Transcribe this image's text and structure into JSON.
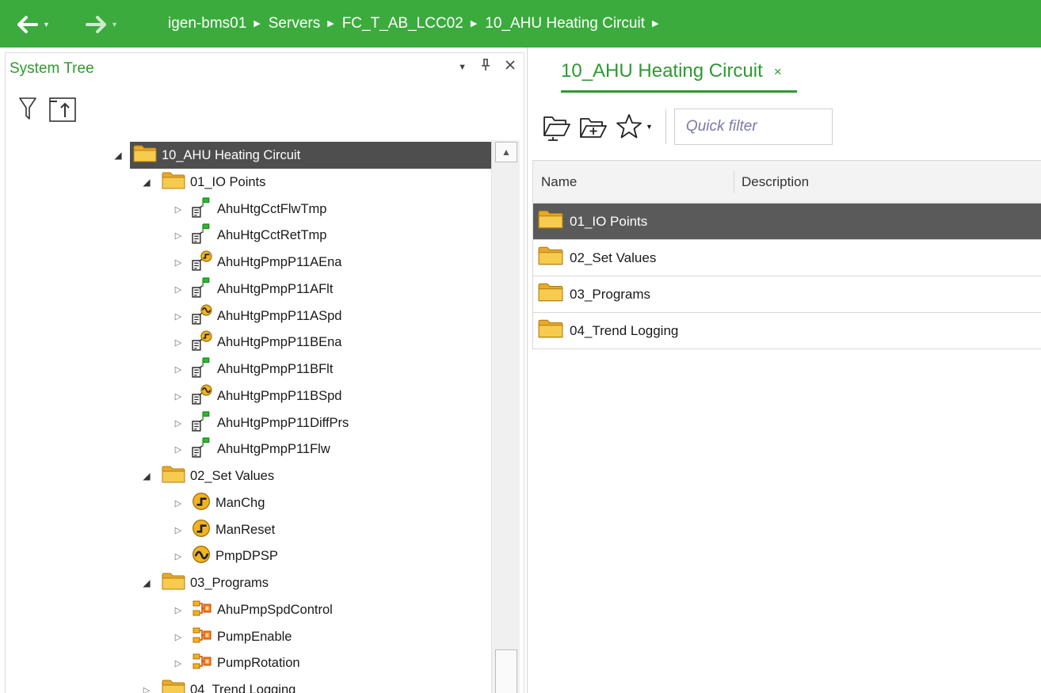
{
  "theme": {
    "accent": "#3bab3d",
    "accent_text": "#2e9a31",
    "selection": "#4e4e4e"
  },
  "nav": {
    "back_icon": "arrow-left-icon",
    "forward_icon": "arrow-right-icon",
    "breadcrumb": [
      "igen-bms01",
      "Servers",
      "FC_T_AB_LCC02",
      "10_AHU Heating Circuit"
    ]
  },
  "tree_panel": {
    "title": "System Tree",
    "header_icons": [
      "dropdown-icon",
      "pin-icon",
      "close-icon"
    ],
    "toolbar_icons": [
      "filter-icon",
      "go-to-parent-icon"
    ]
  },
  "tree": [
    {
      "label": "10_AHU Heating Circuit",
      "icon": "folder",
      "level": 0,
      "expanded": true,
      "selected": true
    },
    {
      "label": "01_IO Points",
      "icon": "folder",
      "level": 1,
      "expanded": true
    },
    {
      "label": "AhuHtgCctFlwTmp",
      "icon": "io-analog-input",
      "level": 2,
      "expanded": false
    },
    {
      "label": "AhuHtgCctRetTmp",
      "icon": "io-analog-input",
      "level": 2,
      "expanded": false
    },
    {
      "label": "AhuHtgPmpP11AEna",
      "icon": "io-digital-output",
      "level": 2,
      "expanded": false
    },
    {
      "label": "AhuHtgPmpP11AFlt",
      "icon": "io-analog-input",
      "level": 2,
      "expanded": false
    },
    {
      "label": "AhuHtgPmpP11ASpd",
      "icon": "io-analog-output",
      "level": 2,
      "expanded": false
    },
    {
      "label": "AhuHtgPmpP11BEna",
      "icon": "io-digital-output",
      "level": 2,
      "expanded": false
    },
    {
      "label": "AhuHtgPmpP11BFlt",
      "icon": "io-analog-input",
      "level": 2,
      "expanded": false
    },
    {
      "label": "AhuHtgPmpP11BSpd",
      "icon": "io-analog-output",
      "level": 2,
      "expanded": false
    },
    {
      "label": "AhuHtgPmpP11DiffPrs",
      "icon": "io-analog-input",
      "level": 2,
      "expanded": false
    },
    {
      "label": "AhuHtgPmpP11Flw",
      "icon": "io-analog-input",
      "level": 2,
      "expanded": false
    },
    {
      "label": "02_Set Values",
      "icon": "folder",
      "level": 1,
      "expanded": true
    },
    {
      "label": "ManChg",
      "icon": "digital-value",
      "level": 2,
      "expanded": false
    },
    {
      "label": "ManReset",
      "icon": "digital-value",
      "level": 2,
      "expanded": false
    },
    {
      "label": "PmpDPSP",
      "icon": "analog-value",
      "level": 2,
      "expanded": false
    },
    {
      "label": "03_Programs",
      "icon": "folder",
      "level": 1,
      "expanded": true
    },
    {
      "label": "AhuPmpSpdControl",
      "icon": "program",
      "level": 2,
      "expanded": false
    },
    {
      "label": "PumpEnable",
      "icon": "program",
      "level": 2,
      "expanded": false
    },
    {
      "label": "PumpRotation",
      "icon": "program",
      "level": 2,
      "expanded": false
    },
    {
      "label": "04_Trend Logging",
      "icon": "folder",
      "level": 1,
      "expanded": false
    }
  ],
  "content": {
    "tab_title": "10_AHU Heating Circuit",
    "tab_close": "×",
    "toolbar_icons": [
      "browse-folder-icon",
      "new-folder-icon",
      "favorites-star-icon"
    ],
    "quick_filter_placeholder": "Quick filter",
    "columns": [
      "Name",
      "Description"
    ],
    "rows": [
      {
        "name": "01_IO Points",
        "description": "",
        "selected": true
      },
      {
        "name": "02_Set Values",
        "description": "",
        "selected": false
      },
      {
        "name": "03_Programs",
        "description": "",
        "selected": false
      },
      {
        "name": "04_Trend Logging",
        "description": "",
        "selected": false
      }
    ]
  }
}
